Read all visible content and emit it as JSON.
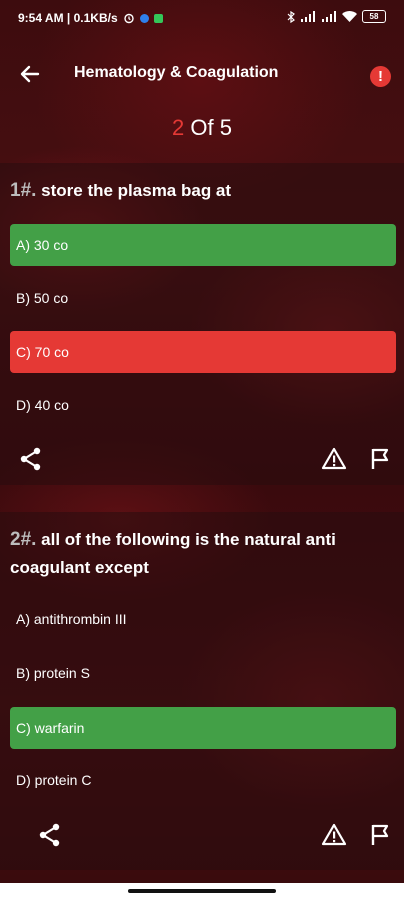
{
  "status": {
    "left_text": "9:54 AM | 0.1KB/s",
    "battery": "58"
  },
  "appbar": {
    "title": "Hematology & Coagulation"
  },
  "progress": {
    "current": "2",
    "separator": " Of ",
    "total": "5"
  },
  "questions": [
    {
      "number": "1#.",
      "text": "store the plasma bag at",
      "options": [
        {
          "label": "A) 30 co",
          "state": "correct"
        },
        {
          "label": "B) 50 co",
          "state": "none"
        },
        {
          "label": "C) 70 co",
          "state": "wrong"
        },
        {
          "label": "D) 40 co",
          "state": "none"
        }
      ]
    },
    {
      "number": "2#.",
      "text": "all of the following is the natural anti coagulant except",
      "options": [
        {
          "label": "A) antithrombin III",
          "state": "none"
        },
        {
          "label": "B) protein S",
          "state": "none"
        },
        {
          "label": "C) warfarin",
          "state": "correct"
        },
        {
          "label": "D) protein C",
          "state": "none"
        }
      ]
    }
  ],
  "colors": {
    "correct": "#43a047",
    "wrong": "#e53935",
    "accent": "#e53935"
  },
  "icons": [
    "back-arrow-icon",
    "alert-icon",
    "share-icon",
    "warning-icon",
    "flag-icon",
    "alarm-icon",
    "bluetooth-icon",
    "signal-icon",
    "wifi-icon",
    "battery-icon"
  ]
}
